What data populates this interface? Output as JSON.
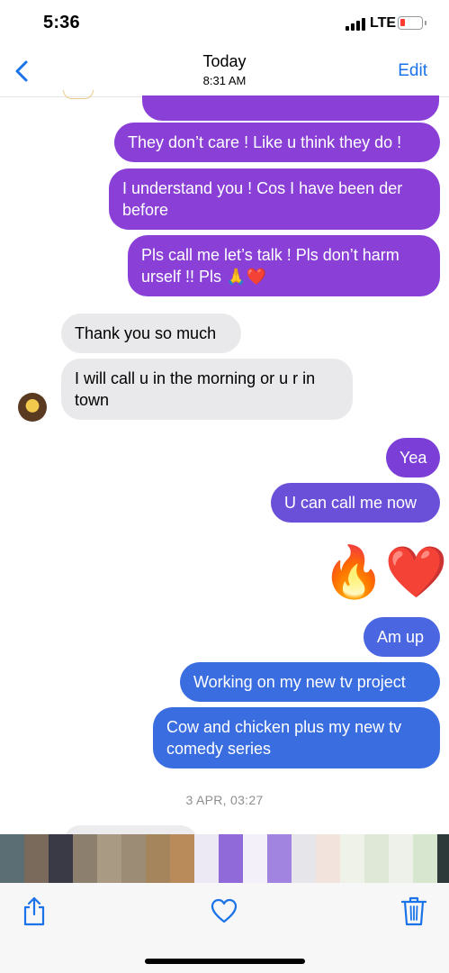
{
  "status_bar": {
    "time": "5:36",
    "network": "LTE"
  },
  "nav": {
    "title": "Today",
    "subtitle": "8:31 AM",
    "edit_label": "Edit"
  },
  "messages": [
    {
      "text": "They don’t care ! Like u think they do !",
      "direction": "outgoing",
      "color": "#8a3fd6"
    },
    {
      "text": "I understand you ! Cos I have been der before",
      "direction": "outgoing",
      "color": "#8a3fd6"
    },
    {
      "text": "Pls call me let’s talk ! Pls don’t harm urself !! Pls 🙏❤️",
      "direction": "outgoing",
      "color": "#8a3fd6"
    },
    {
      "text": "Thank you so much",
      "direction": "incoming",
      "color": "#e9e9eb"
    },
    {
      "text": "I will call u in the morning or u r in town",
      "direction": "incoming",
      "color": "#e9e9eb"
    },
    {
      "text": "Yea",
      "direction": "outgoing",
      "color": "#8a3fd6"
    },
    {
      "text": "U can call me now",
      "direction": "outgoing",
      "color": "#6a4fd9"
    },
    {
      "text": "🔥❤️",
      "direction": "outgoing",
      "type": "emoji"
    },
    {
      "text": "Am up",
      "direction": "outgoing",
      "color": "#3a6ee0"
    },
    {
      "text": "Working on my new tv project",
      "direction": "outgoing",
      "color": "#3a6ee0"
    },
    {
      "text": "Cow and chicken plus my new tv comedy series",
      "direction": "outgoing",
      "color": "#3a6ee0"
    }
  ],
  "timestamp": "3 APR, 03:27",
  "toolbar": {
    "share": "share-icon",
    "favorite": "heart-icon",
    "delete": "trash-icon"
  },
  "colors": {
    "accent": "#1a73e8",
    "purple": "#8a3fd6",
    "blue": "#3a6ee0",
    "gray": "#e9e9eb"
  }
}
